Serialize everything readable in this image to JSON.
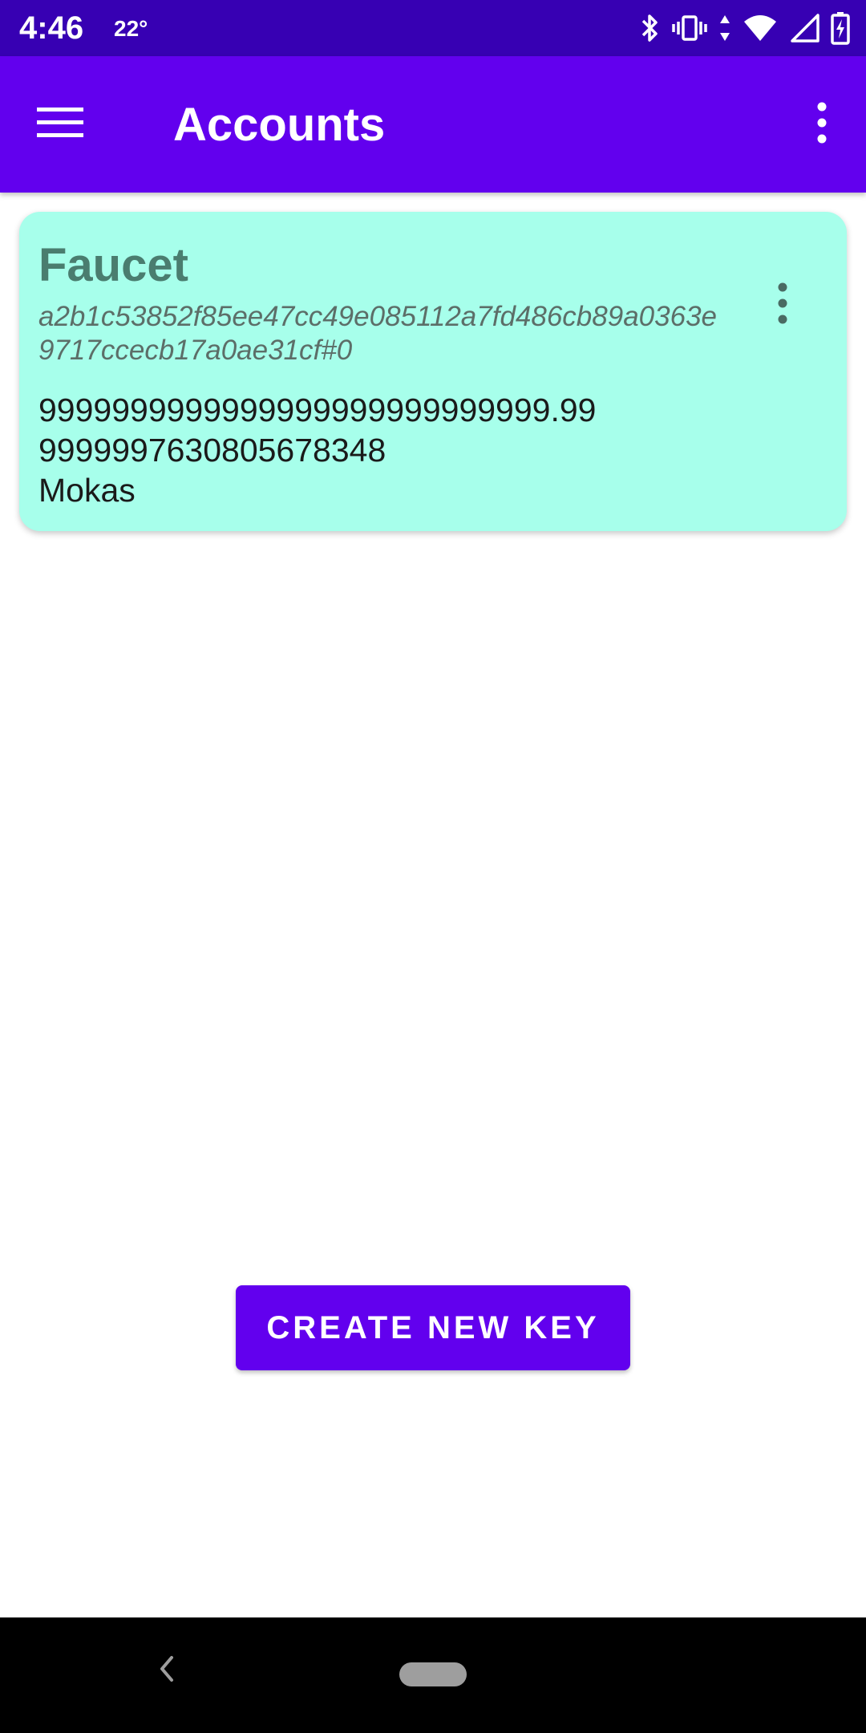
{
  "status_bar": {
    "time": "4:46",
    "temperature": "22°",
    "icons": [
      "bluetooth-icon",
      "vibrate-icon",
      "data-arrows-icon",
      "wifi-icon",
      "signal-icon",
      "battery-charging-icon"
    ],
    "background_color": "#3700b3"
  },
  "app_bar": {
    "title": "Accounts",
    "menu_icon": "hamburger-menu-icon",
    "overflow_icon": "more-vertical-icon",
    "background_color": "#6200ee"
  },
  "accounts": [
    {
      "name": "Faucet",
      "address": "a2b1c53852f85ee47cc49e085112a7fd486cb89a0363e9717ccecb17a0ae31cf#0",
      "balance": "9999999999999999999999999999.999999997630805678348",
      "unit": "Mokas",
      "menu_icon": "more-vertical-icon",
      "card_color": "#a7ffeb"
    }
  ],
  "actions": {
    "create_key_label": "CREATE NEW KEY",
    "button_color": "#6200ee"
  },
  "navigation": {
    "back_icon": "back-chevron-icon",
    "home_icon": "home-pill-icon"
  }
}
